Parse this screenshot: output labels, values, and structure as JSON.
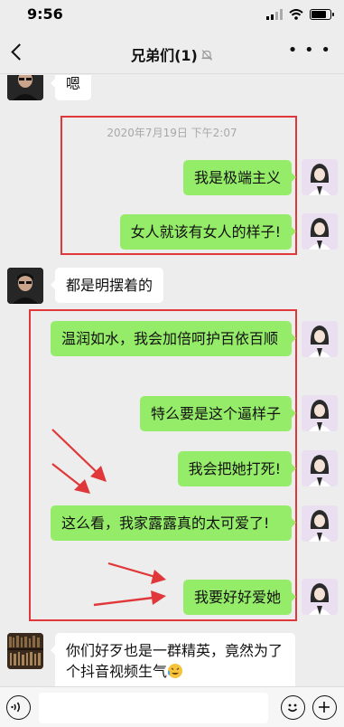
{
  "status": {
    "time": "9:56"
  },
  "nav": {
    "title": "兄弟们(1)"
  },
  "timestamp": "2020年7月19日 下午2:07",
  "messages": {
    "m0": "嗯",
    "m1": "我是极端主义",
    "m2": "女人就该有女人的样子!",
    "m3": "都是明摆着的",
    "m4": "温润如水，我会加倍呵护百依百顺",
    "m5": "特么要是这个逼样子",
    "m6": "我会把她打死!",
    "m7": "这么看，我家露露真的太可爱了!",
    "m8": "我要好好爱她",
    "m9": "你们好歹也是一群精英，竟然为了个抖音视频生气"
  },
  "colors": {
    "out_bubble": "#95ec69",
    "in_bubble": "#ffffff",
    "annotation": "#e0383a"
  },
  "icons": [
    "back-icon",
    "mute-bell-icon",
    "more-icon",
    "voice-icon",
    "emoji-icon",
    "plus-icon",
    "crying-laugh-emoji"
  ]
}
